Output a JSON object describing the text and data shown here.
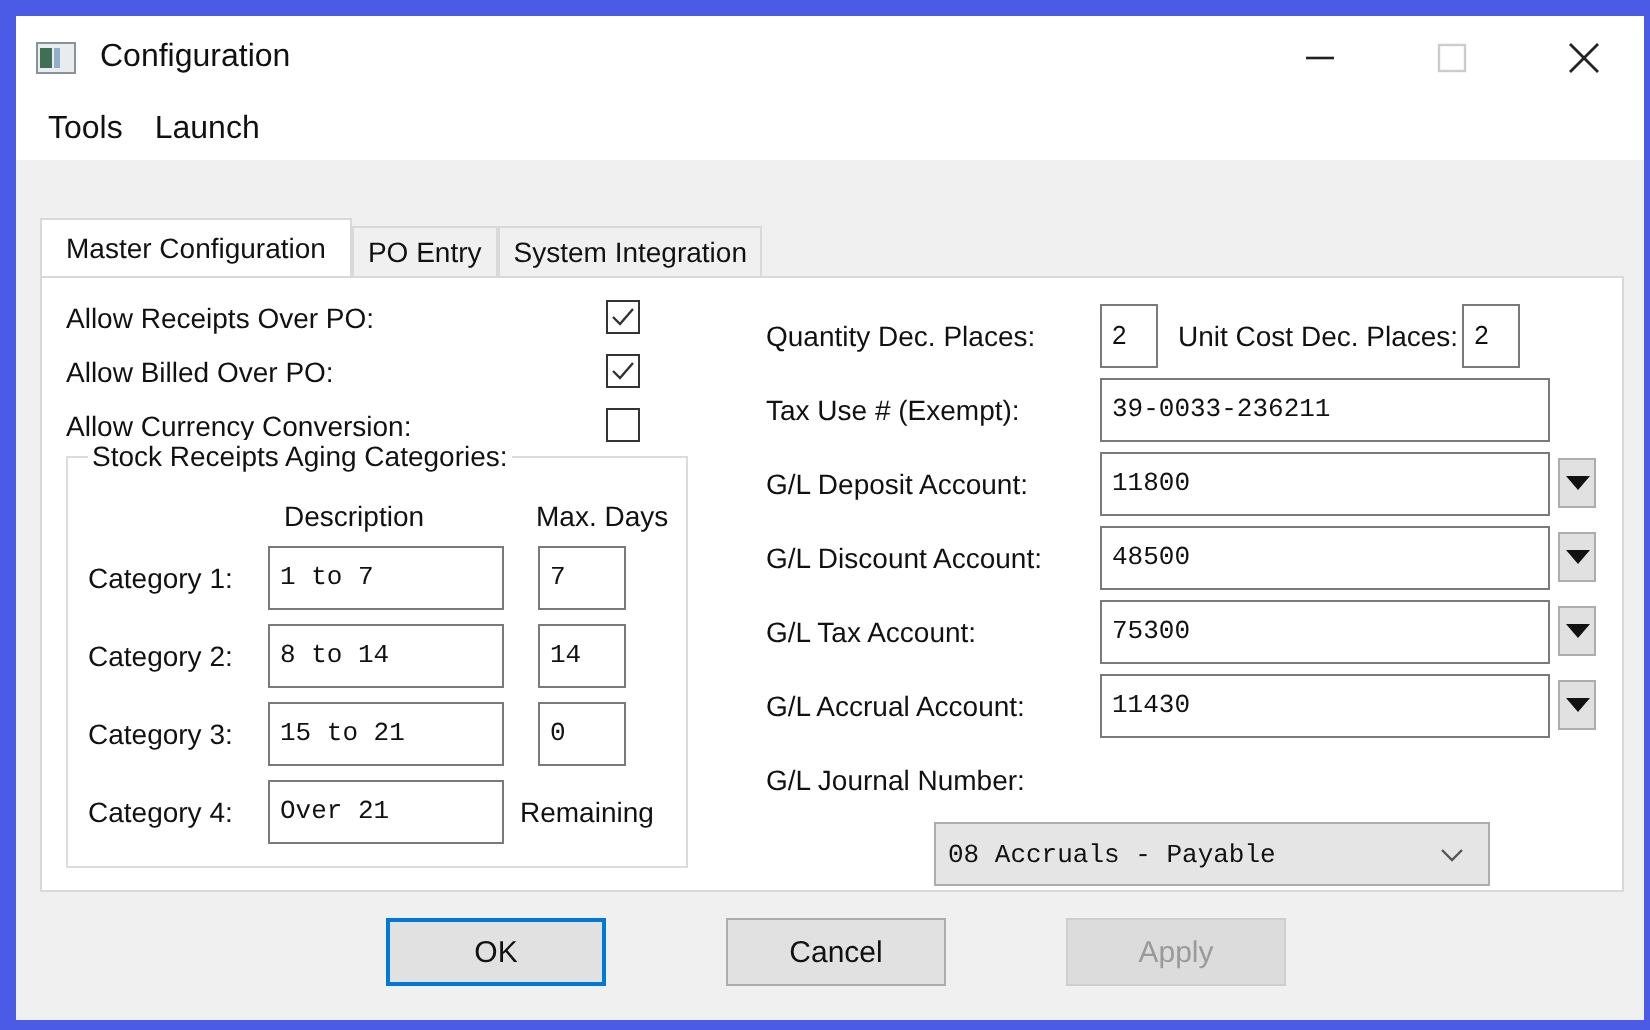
{
  "window": {
    "title": "Configuration"
  },
  "menu": [
    "Tools",
    "Launch"
  ],
  "tabs": [
    {
      "label": "Master Configuration",
      "selected": true
    },
    {
      "label": "PO Entry",
      "selected": false
    },
    {
      "label": "System Integration",
      "selected": false
    }
  ],
  "options": [
    {
      "label": "Allow Receipts Over PO:",
      "checked": true
    },
    {
      "label": "Allow Billed Over PO:",
      "checked": true
    },
    {
      "label": "Allow Currency Conversion:",
      "checked": false
    }
  ],
  "aging": {
    "title": "Stock Receipts Aging Categories:",
    "columns": [
      "Description",
      "Max. Days"
    ],
    "rows": [
      {
        "label": "Category 1:",
        "description": "1 to 7",
        "max_days": "7",
        "kind": "field"
      },
      {
        "label": "Category 2:",
        "description": "8 to 14",
        "max_days": "14",
        "kind": "field"
      },
      {
        "label": "Category 3:",
        "description": "15 to 21",
        "max_days": "0",
        "kind": "field"
      },
      {
        "label": "Category 4:",
        "description": "Over 21",
        "max_days": "Remaining",
        "kind": "text"
      }
    ]
  },
  "decimals": {
    "quantity_label": "Quantity Dec. Places:",
    "quantity_value": "2",
    "unit_cost_label": "Unit Cost Dec. Places:",
    "unit_cost_value": "2"
  },
  "tax_use": {
    "label": "Tax Use # (Exempt):",
    "value": "39-0033-236211"
  },
  "accounts": [
    {
      "label": "G/L Deposit Account:",
      "value": "11800"
    },
    {
      "label": "G/L Discount Account:",
      "value": "48500"
    },
    {
      "label": "G/L Tax Account:",
      "value": "75300"
    },
    {
      "label": "G/L Accrual Account:",
      "value": "11430"
    }
  ],
  "journal": {
    "label": "G/L Journal Number:",
    "value": "08 Accruals - Payable"
  },
  "buttons": [
    {
      "label": "OK",
      "default": true,
      "disabled": false
    },
    {
      "label": "Cancel",
      "default": false,
      "disabled": false
    },
    {
      "label": "Apply",
      "default": false,
      "disabled": true
    }
  ]
}
